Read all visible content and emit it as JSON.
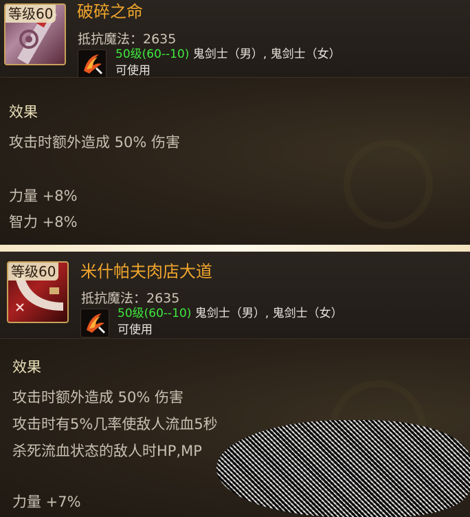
{
  "cards": [
    {
      "level_badge": "等级60",
      "name": "破碎之命",
      "stat": "抵抗魔法：2635",
      "requirement_level": "50级(60--10)",
      "requirement_classes": " 鬼剑士（男）, 鬼剑士（女）",
      "usable": "可使用",
      "effect_title": "效果",
      "effects": [
        "攻击时额外造成 50% 伤害"
      ],
      "bonuses": [
        "力量 +8%",
        "智力 +8%"
      ],
      "icon": "hammer-weapon-icon"
    },
    {
      "level_badge": "等级60",
      "name": "米什帕夫肉店大道",
      "stat": "抵抗魔法：2635",
      "requirement_level": "50级(60--10)",
      "requirement_classes": " 鬼剑士（男）, 鬼剑士（女）",
      "usable": "可使用",
      "effect_title": "效果",
      "effects": [
        "攻击时额外造成 50% 伤害",
        "攻击时有5%几率使敌人流血5秒",
        "杀死流血状态的敌人时HP,MP"
      ],
      "bonuses": [
        "力量 +7%"
      ],
      "icon": "curved-blade-weapon-icon"
    }
  ],
  "colors": {
    "item_name": "#f0a62c",
    "requirement_level": "#3ee83e",
    "separator": "#fff9ea"
  }
}
